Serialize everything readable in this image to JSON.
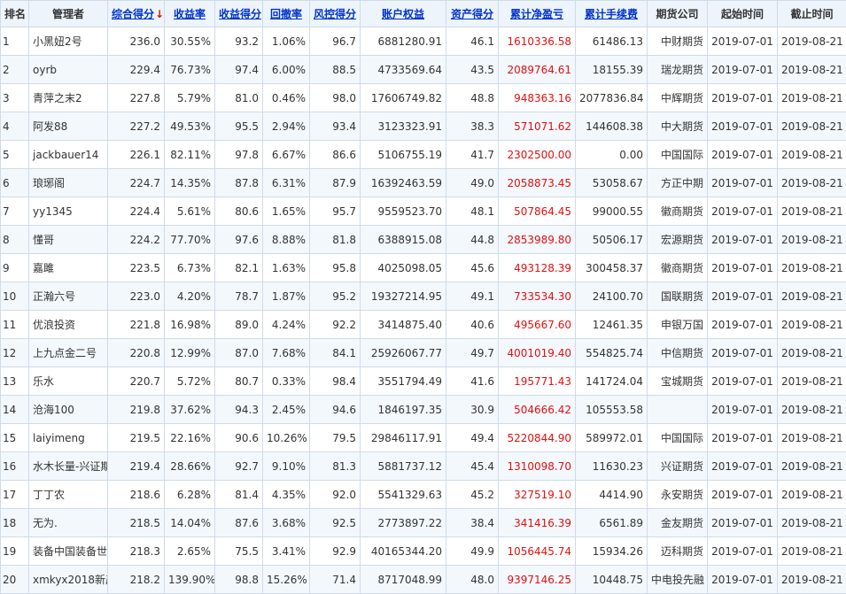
{
  "accent_red": "#e01010",
  "link_blue": "#0033cc",
  "headers": {
    "rank": "排名",
    "manager": "管理者",
    "total_score": "综合得分",
    "sort_arrow": "↓",
    "return_rate": "收益率",
    "return_score": "收益得分",
    "drawdown": "回撤率",
    "risk_score": "风控得分",
    "equity": "账户权益",
    "asset_score": "资产得分",
    "cum_pnl": "累计净盈亏",
    "cum_fee": "累计手续费",
    "broker": "期货公司",
    "start": "起始时间",
    "end": "截止时间"
  },
  "rows": [
    {
      "rank": "1",
      "manager": "小黑妞2号",
      "total": "236.0",
      "ret": "30.55%",
      "ret_score": "93.2",
      "dd": "1.06%",
      "risk": "96.7",
      "equity": "6881280.91",
      "asset": "46.1",
      "pnl": "1610336.58",
      "fee": "61486.13",
      "broker": "中财期货",
      "start": "2019-07-01",
      "end": "2019-08-21"
    },
    {
      "rank": "2",
      "manager": "oyrb",
      "total": "229.4",
      "ret": "76.73%",
      "ret_score": "97.4",
      "dd": "6.00%",
      "risk": "88.5",
      "equity": "4733569.64",
      "asset": "43.5",
      "pnl": "2089764.61",
      "fee": "18155.39",
      "broker": "瑞龙期货",
      "start": "2019-07-01",
      "end": "2019-08-21"
    },
    {
      "rank": "3",
      "manager": "青萍之末2",
      "total": "227.8",
      "ret": "5.79%",
      "ret_score": "81.0",
      "dd": "0.46%",
      "risk": "98.0",
      "equity": "17606749.82",
      "asset": "48.8",
      "pnl": "948363.16",
      "fee": "2077836.84",
      "broker": "中辉期货",
      "start": "2019-07-01",
      "end": "2019-08-21"
    },
    {
      "rank": "4",
      "manager": "阿发88",
      "total": "227.2",
      "ret": "49.53%",
      "ret_score": "95.5",
      "dd": "2.94%",
      "risk": "93.4",
      "equity": "3123323.91",
      "asset": "38.3",
      "pnl": "571071.62",
      "fee": "144608.38",
      "broker": "中大期货",
      "start": "2019-07-01",
      "end": "2019-08-21"
    },
    {
      "rank": "5",
      "manager": "jackbauer14",
      "total": "226.1",
      "ret": "82.11%",
      "ret_score": "97.8",
      "dd": "6.67%",
      "risk": "86.6",
      "equity": "5106755.19",
      "asset": "41.7",
      "pnl": "2302500.00",
      "fee": "0.00",
      "broker": "中国国际",
      "start": "2019-07-01",
      "end": "2019-08-21"
    },
    {
      "rank": "6",
      "manager": "琅琊阁",
      "total": "224.7",
      "ret": "14.35%",
      "ret_score": "87.8",
      "dd": "6.31%",
      "risk": "87.9",
      "equity": "16392463.59",
      "asset": "49.0",
      "pnl": "2058873.45",
      "fee": "53058.67",
      "broker": "方正中期",
      "start": "2019-07-01",
      "end": "2019-08-21"
    },
    {
      "rank": "7",
      "manager": "yy1345",
      "total": "224.4",
      "ret": "5.61%",
      "ret_score": "80.6",
      "dd": "1.65%",
      "risk": "95.7",
      "equity": "9559523.70",
      "asset": "48.1",
      "pnl": "507864.45",
      "fee": "99000.55",
      "broker": "徽商期货",
      "start": "2019-07-01",
      "end": "2019-08-21"
    },
    {
      "rank": "8",
      "manager": "懂哥",
      "total": "224.2",
      "ret": "77.70%",
      "ret_score": "97.6",
      "dd": "8.88%",
      "risk": "81.8",
      "equity": "6388915.08",
      "asset": "44.8",
      "pnl": "2853989.80",
      "fee": "50506.17",
      "broker": "宏源期货",
      "start": "2019-07-01",
      "end": "2019-08-21"
    },
    {
      "rank": "9",
      "manager": "嘉雎",
      "total": "223.5",
      "ret": "6.73%",
      "ret_score": "82.1",
      "dd": "1.63%",
      "risk": "95.8",
      "equity": "4025098.05",
      "asset": "45.6",
      "pnl": "493128.39",
      "fee": "300458.37",
      "broker": "徽商期货",
      "start": "2019-07-01",
      "end": "2019-08-21"
    },
    {
      "rank": "10",
      "manager": "正瀚六号",
      "total": "223.0",
      "ret": "4.20%",
      "ret_score": "78.7",
      "dd": "1.87%",
      "risk": "95.2",
      "equity": "19327214.95",
      "asset": "49.1",
      "pnl": "733534.30",
      "fee": "24100.70",
      "broker": "国联期货",
      "start": "2019-07-01",
      "end": "2019-08-21"
    },
    {
      "rank": "11",
      "manager": "优浪投资",
      "total": "221.8",
      "ret": "16.98%",
      "ret_score": "89.0",
      "dd": "4.24%",
      "risk": "92.2",
      "equity": "3414875.40",
      "asset": "40.6",
      "pnl": "495667.60",
      "fee": "12461.35",
      "broker": "申银万国",
      "start": "2019-07-01",
      "end": "2019-08-21"
    },
    {
      "rank": "12",
      "manager": "上九点金二号",
      "total": "220.8",
      "ret": "12.99%",
      "ret_score": "87.0",
      "dd": "7.68%",
      "risk": "84.1",
      "equity": "25926067.77",
      "asset": "49.7",
      "pnl": "4001019.40",
      "fee": "554825.74",
      "broker": "中信期货",
      "start": "2019-07-01",
      "end": "2019-08-21"
    },
    {
      "rank": "13",
      "manager": "乐水",
      "total": "220.7",
      "ret": "5.72%",
      "ret_score": "80.7",
      "dd": "0.33%",
      "risk": "98.4",
      "equity": "3551794.49",
      "asset": "41.6",
      "pnl": "195771.43",
      "fee": "141724.04",
      "broker": "宝城期货",
      "start": "2019-07-01",
      "end": "2019-08-21"
    },
    {
      "rank": "14",
      "manager": "沧海100",
      "total": "219.8",
      "ret": "37.62%",
      "ret_score": "94.3",
      "dd": "2.45%",
      "risk": "94.6",
      "equity": "1846197.35",
      "asset": "30.9",
      "pnl": "504666.42",
      "fee": "105553.58",
      "broker": "",
      "start": "2019-07-01",
      "end": "2019-08-21"
    },
    {
      "rank": "15",
      "manager": "laiyimeng",
      "total": "219.5",
      "ret": "22.16%",
      "ret_score": "90.6",
      "dd": "10.26%",
      "risk": "79.5",
      "equity": "29846117.91",
      "asset": "49.4",
      "pnl": "5220844.90",
      "fee": "589972.01",
      "broker": "中国国际",
      "start": "2019-07-01",
      "end": "2019-08-21"
    },
    {
      "rank": "16",
      "manager": "水木长量-兴证期",
      "total": "219.4",
      "ret": "28.66%",
      "ret_score": "92.7",
      "dd": "9.10%",
      "risk": "81.3",
      "equity": "5881737.12",
      "asset": "45.4",
      "pnl": "1310098.70",
      "fee": "11630.23",
      "broker": "兴证期货",
      "start": "2019-07-01",
      "end": "2019-08-21"
    },
    {
      "rank": "17",
      "manager": "丁丁农",
      "total": "218.6",
      "ret": "6.28%",
      "ret_score": "81.4",
      "dd": "4.35%",
      "risk": "92.0",
      "equity": "5541329.63",
      "asset": "45.2",
      "pnl": "327519.10",
      "fee": "4414.90",
      "broker": "永安期货",
      "start": "2019-07-01",
      "end": "2019-08-21"
    },
    {
      "rank": "18",
      "manager": "无为.",
      "total": "218.5",
      "ret": "14.04%",
      "ret_score": "87.6",
      "dd": "3.68%",
      "risk": "92.5",
      "equity": "2773897.22",
      "asset": "38.4",
      "pnl": "341416.39",
      "fee": "6561.89",
      "broker": "金友期货",
      "start": "2019-07-01",
      "end": "2019-08-21"
    },
    {
      "rank": "19",
      "manager": "装备中国装备世",
      "total": "218.3",
      "ret": "2.65%",
      "ret_score": "75.5",
      "dd": "3.41%",
      "risk": "92.9",
      "equity": "40165344.20",
      "asset": "49.9",
      "pnl": "1056445.74",
      "fee": "15934.26",
      "broker": "迈科期货",
      "start": "2019-07-01",
      "end": "2019-08-21"
    },
    {
      "rank": "20",
      "manager": "xmkyx2018新产",
      "total": "218.2",
      "ret": "139.90%",
      "ret_score": "98.8",
      "dd": "15.26%",
      "risk": "71.4",
      "equity": "8717048.99",
      "asset": "48.0",
      "pnl": "9397146.25",
      "fee": "10448.75",
      "broker": "中电投先融",
      "start": "2019-07-01",
      "end": "2019-08-21"
    }
  ]
}
